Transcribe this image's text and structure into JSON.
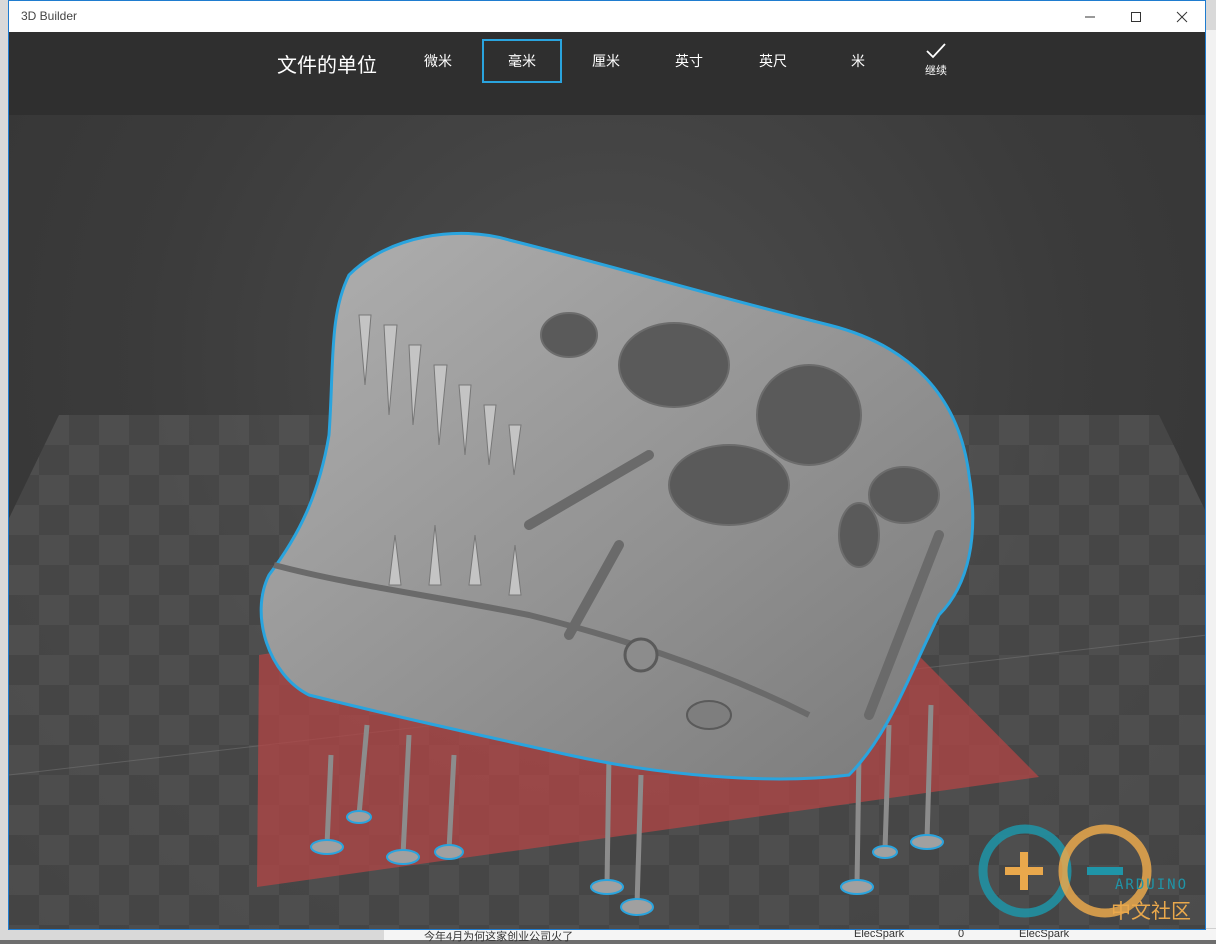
{
  "window": {
    "title": "3D Builder"
  },
  "titlebar": {
    "minimize_icon": "minimize-icon",
    "maximize_icon": "maximize-icon",
    "close_icon": "close-icon"
  },
  "units": {
    "title": "文件的单位",
    "options": [
      "微米",
      "毫米",
      "厘米",
      "英寸",
      "英尺",
      "米"
    ],
    "selected": "毫米",
    "continue_label": "继续",
    "continue_icon": "checkmark-icon"
  },
  "colors": {
    "accent": "#2aa4de",
    "toolbar": "#2f2f2f",
    "build_plate": "#b34545",
    "model": "#9a9a9a"
  },
  "background_text": {
    "row_text": "今年4月为何这家创业公司火了",
    "author": "ElecSpark",
    "count": "0",
    "author2": "ElecSpark"
  },
  "watermark": {
    "brand": "ARDUINO",
    "subtitle": "中文社区"
  }
}
